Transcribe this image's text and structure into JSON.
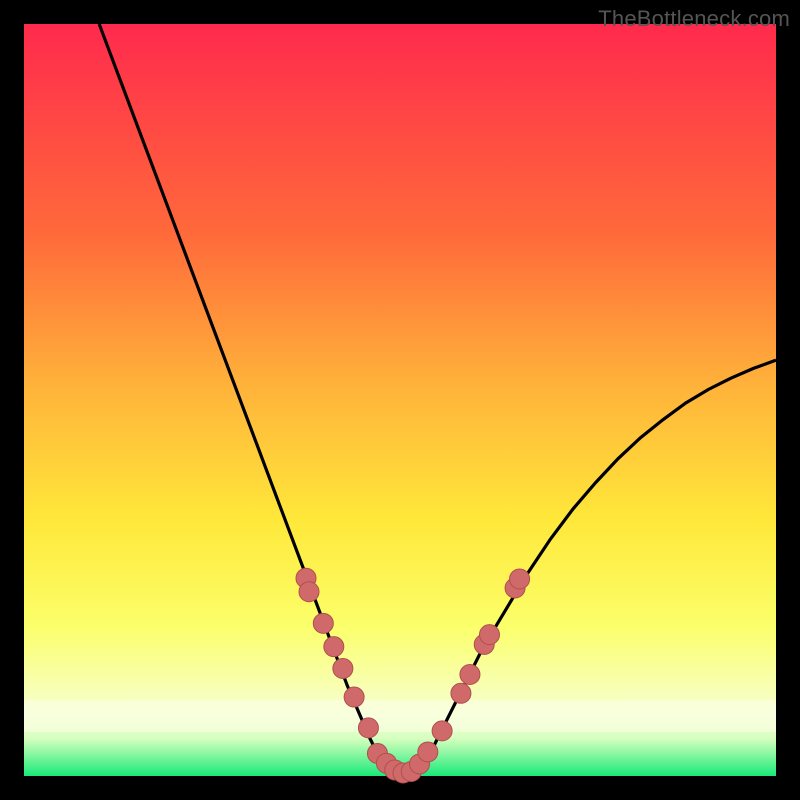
{
  "watermark": "TheBottleneck.com",
  "colors": {
    "gradient_top": "#ff2a4d",
    "gradient_mid1": "#ff8a2a",
    "gradient_mid2": "#ffe83a",
    "gradient_mid3": "#fbff6a",
    "gradient_bottom_band": "#f5ffc2",
    "gradient_bottom": "#19e97a",
    "border": "#000000",
    "curve": "#000000",
    "dot_fill": "#d06a6a",
    "dot_stroke": "#b04e4e"
  },
  "chart_data": {
    "type": "line",
    "title": "",
    "xlabel": "",
    "ylabel": "",
    "xlim": [
      0,
      100
    ],
    "ylim": [
      0,
      100
    ],
    "series": [
      {
        "name": "bottleneck-curve",
        "x": [
          10,
          13,
          16,
          19,
          22,
          25,
          28,
          31,
          34,
          37,
          40,
          43,
          46,
          47.5,
          49,
          50.5,
          52,
          53.5,
          55,
          58,
          61,
          64,
          67,
          70,
          73,
          76,
          79,
          82,
          85,
          88,
          91,
          94,
          97,
          100
        ],
        "y": [
          100,
          92,
          84,
          76,
          68,
          60,
          52,
          44,
          36,
          28,
          20,
          12,
          5,
          2,
          0.7,
          0.3,
          0.7,
          2,
          5,
          11,
          17,
          22,
          27,
          31.5,
          35.5,
          39,
          42.2,
          45,
          47.4,
          49.6,
          51.4,
          52.9,
          54.2,
          55.3
        ]
      }
    ],
    "scatter_series": [
      {
        "name": "curve-dots-left",
        "x": [
          37.5,
          37.9,
          39.8,
          41.2,
          42.4,
          43.9,
          45.8
        ],
        "y": [
          26.3,
          24.5,
          20.3,
          17.2,
          14.3,
          10.5,
          6.4
        ]
      },
      {
        "name": "curve-dots-bottom",
        "x": [
          47.0,
          48.2,
          49.3,
          50.4,
          51.5,
          52.6,
          53.7
        ],
        "y": [
          3.0,
          1.7,
          0.8,
          0.4,
          0.6,
          1.6,
          3.2
        ]
      },
      {
        "name": "curve-dots-right",
        "x": [
          55.6,
          58.1,
          59.3,
          61.2,
          61.9,
          65.3,
          65.9
        ],
        "y": [
          6.0,
          11.0,
          13.5,
          17.5,
          18.8,
          25.0,
          26.2
        ]
      }
    ]
  }
}
